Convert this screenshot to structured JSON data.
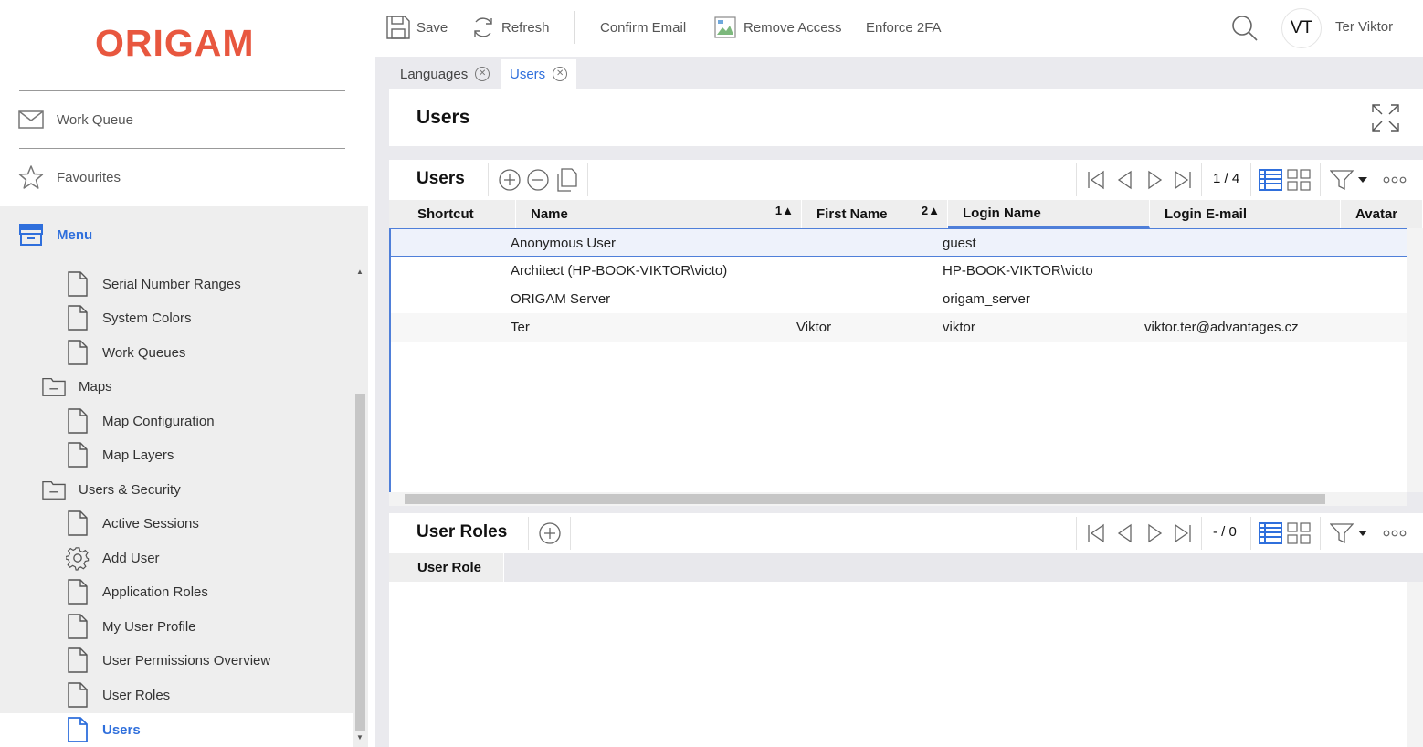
{
  "brand": {
    "logo_text": "ORIGAM",
    "logo_color": "#e8573f"
  },
  "sidebar": {
    "work_queue_label": "Work Queue",
    "favourites_label": "Favourites",
    "menu_label": "Menu",
    "tree": {
      "serial_number_ranges": "Serial Number Ranges",
      "system_colors": "System Colors",
      "work_queues": "Work Queues",
      "maps": "Maps",
      "map_configuration": "Map Configuration",
      "map_layers": "Map Layers",
      "users_security": "Users & Security",
      "active_sessions": "Active Sessions",
      "add_user": "Add User",
      "application_roles": "Application Roles",
      "my_user_profile": "My User Profile",
      "user_permissions_overview": "User Permissions Overview",
      "user_roles": "User Roles",
      "users": "Users"
    }
  },
  "toolbar": {
    "save_label": "Save",
    "refresh_label": "Refresh",
    "confirm_email_label": "Confirm Email",
    "remove_access_label": "Remove Access",
    "enforce_2fa_label": "Enforce 2FA",
    "avatar_initials": "VT",
    "user_name": "Ter Viktor"
  },
  "tabs": [
    {
      "label": "Languages"
    },
    {
      "label": "Users"
    }
  ],
  "page_title": "Users",
  "users_panel": {
    "title": "Users",
    "pager": "1 / 4",
    "columns": {
      "shortcut": "Shortcut",
      "name": "Name",
      "name_sort": "1",
      "first_name": "First Name",
      "first_name_sort": "2",
      "login_name": "Login Name",
      "login_email": "Login E-mail",
      "avatar": "Avatar"
    },
    "rows": [
      {
        "name": "Anonymous User",
        "first_name": "",
        "login_name": "guest",
        "login_email": ""
      },
      {
        "name": "Architect (HP-BOOK-VIKTOR\\victo)",
        "first_name": "",
        "login_name": "HP-BOOK-VIKTOR\\victo",
        "login_email": ""
      },
      {
        "name": "ORIGAM Server",
        "first_name": "",
        "login_name": "origam_server",
        "login_email": ""
      },
      {
        "name": "Ter",
        "first_name": "Viktor",
        "login_name": "viktor",
        "login_email": "viktor.ter@advantages.cz"
      }
    ]
  },
  "roles_panel": {
    "title": "User Roles",
    "pager": "- / 0",
    "columns": {
      "user_role": "User Role"
    }
  },
  "colors": {
    "accent": "#2f6fdc",
    "selection_border": "#4f7fd9"
  }
}
